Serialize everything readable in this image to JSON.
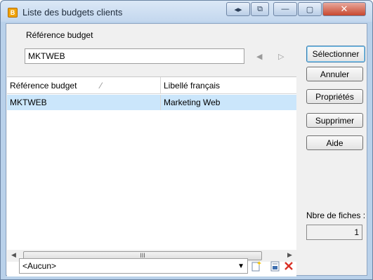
{
  "window": {
    "title": "Liste des budgets clients",
    "app_icon": "B"
  },
  "titlebar_buttons": {
    "nav": "◂▸",
    "restore_small": "⧉",
    "minimize": "—",
    "maximize": "▢",
    "close": "✕"
  },
  "search": {
    "label": "Référence budget",
    "value": "MKTWEB"
  },
  "nav_arrows": {
    "prev": "◀",
    "next": "▷"
  },
  "buttons": {
    "select": "Sélectionner",
    "cancel": "Annuler",
    "properties": "Propriétés",
    "delete": "Supprimer",
    "help": "Aide"
  },
  "grid": {
    "columns": [
      "Référence budget",
      "Libellé français"
    ],
    "sort_indicator": "⁄",
    "rows": [
      [
        "MKTWEB",
        "Marketing Web"
      ]
    ]
  },
  "record_count": {
    "label": "Nbre de fiches :",
    "value": "1"
  },
  "scrollbar": {
    "left": "◀",
    "right": "▶",
    "grip": "III"
  },
  "filter": {
    "value": "<Aucun>",
    "dropdown_arrow": "▼"
  },
  "colors": {
    "selection": "#cbe6fb",
    "frame": "#b9d1ea",
    "delete_icon": "#d93025"
  }
}
